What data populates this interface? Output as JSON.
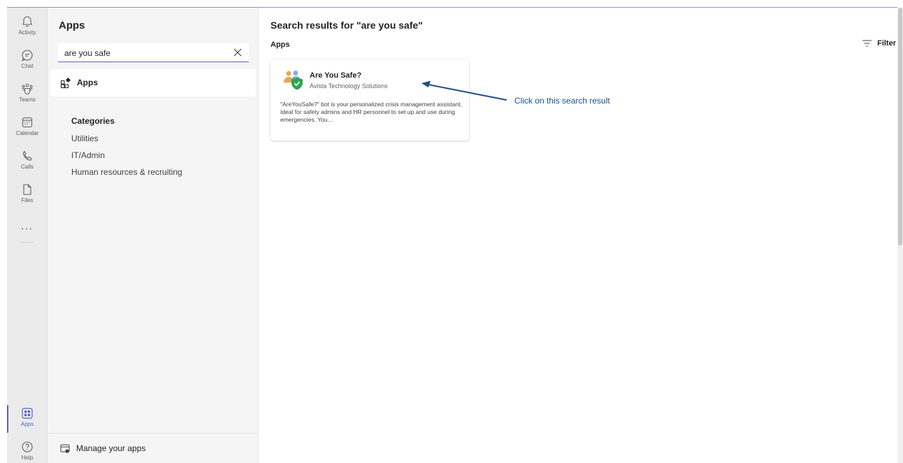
{
  "rail": {
    "items": [
      {
        "label": "Activity",
        "icon": "bell-icon"
      },
      {
        "label": "Chat",
        "icon": "chat-icon"
      },
      {
        "label": "Teams",
        "icon": "teams-icon"
      },
      {
        "label": "Calendar",
        "icon": "calendar-icon"
      },
      {
        "label": "Calls",
        "icon": "phone-icon"
      },
      {
        "label": "Files",
        "icon": "file-icon"
      }
    ],
    "more": "...",
    "apps_label": "Apps",
    "help_label": "Help"
  },
  "panel": {
    "title": "Apps",
    "search": {
      "value": "are you safe",
      "placeholder": "Search"
    },
    "apps_nav_label": "Apps",
    "categories_title": "Categories",
    "categories": [
      "Utilities",
      "IT/Admin",
      "Human resources & recruiting"
    ],
    "manage_label": "Manage your apps"
  },
  "main": {
    "results_title": "Search results for \"are you safe\"",
    "section_label": "Apps",
    "filter_label": "Filter",
    "card": {
      "name": "Are You Safe?",
      "publisher": "Avista Technology Solutions",
      "description": "\"AreYouSafe?\" bot is your personalized crisis management assistant. Ideal for safety admins and HR personnel to set up and use during emergencies. You..."
    },
    "annotation": "Click on this search result"
  },
  "colors": {
    "accent": "#5b5fc7",
    "annotation": "#1f4e8c",
    "rail_bg": "#ebebeb",
    "panel_bg": "#f5f5f5"
  }
}
